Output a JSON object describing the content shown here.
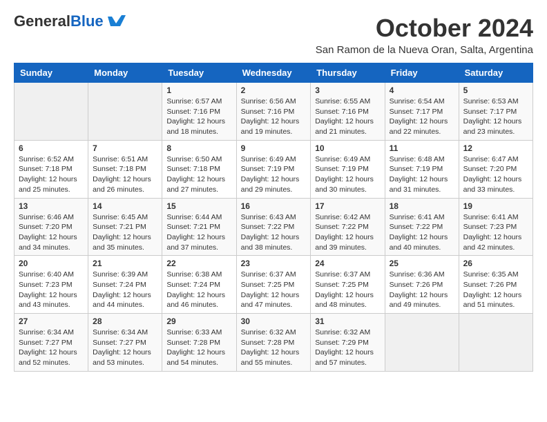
{
  "header": {
    "logo_general": "General",
    "logo_blue": "Blue",
    "month_title": "October 2024",
    "location": "San Ramon de la Nueva Oran, Salta, Argentina"
  },
  "weekdays": [
    "Sunday",
    "Monday",
    "Tuesday",
    "Wednesday",
    "Thursday",
    "Friday",
    "Saturday"
  ],
  "weeks": [
    [
      {
        "day": "",
        "info": ""
      },
      {
        "day": "",
        "info": ""
      },
      {
        "day": "1",
        "info": "Sunrise: 6:57 AM\nSunset: 7:16 PM\nDaylight: 12 hours and 18 minutes."
      },
      {
        "day": "2",
        "info": "Sunrise: 6:56 AM\nSunset: 7:16 PM\nDaylight: 12 hours and 19 minutes."
      },
      {
        "day": "3",
        "info": "Sunrise: 6:55 AM\nSunset: 7:16 PM\nDaylight: 12 hours and 21 minutes."
      },
      {
        "day": "4",
        "info": "Sunrise: 6:54 AM\nSunset: 7:17 PM\nDaylight: 12 hours and 22 minutes."
      },
      {
        "day": "5",
        "info": "Sunrise: 6:53 AM\nSunset: 7:17 PM\nDaylight: 12 hours and 23 minutes."
      }
    ],
    [
      {
        "day": "6",
        "info": "Sunrise: 6:52 AM\nSunset: 7:18 PM\nDaylight: 12 hours and 25 minutes."
      },
      {
        "day": "7",
        "info": "Sunrise: 6:51 AM\nSunset: 7:18 PM\nDaylight: 12 hours and 26 minutes."
      },
      {
        "day": "8",
        "info": "Sunrise: 6:50 AM\nSunset: 7:18 PM\nDaylight: 12 hours and 27 minutes."
      },
      {
        "day": "9",
        "info": "Sunrise: 6:49 AM\nSunset: 7:19 PM\nDaylight: 12 hours and 29 minutes."
      },
      {
        "day": "10",
        "info": "Sunrise: 6:49 AM\nSunset: 7:19 PM\nDaylight: 12 hours and 30 minutes."
      },
      {
        "day": "11",
        "info": "Sunrise: 6:48 AM\nSunset: 7:19 PM\nDaylight: 12 hours and 31 minutes."
      },
      {
        "day": "12",
        "info": "Sunrise: 6:47 AM\nSunset: 7:20 PM\nDaylight: 12 hours and 33 minutes."
      }
    ],
    [
      {
        "day": "13",
        "info": "Sunrise: 6:46 AM\nSunset: 7:20 PM\nDaylight: 12 hours and 34 minutes."
      },
      {
        "day": "14",
        "info": "Sunrise: 6:45 AM\nSunset: 7:21 PM\nDaylight: 12 hours and 35 minutes."
      },
      {
        "day": "15",
        "info": "Sunrise: 6:44 AM\nSunset: 7:21 PM\nDaylight: 12 hours and 37 minutes."
      },
      {
        "day": "16",
        "info": "Sunrise: 6:43 AM\nSunset: 7:22 PM\nDaylight: 12 hours and 38 minutes."
      },
      {
        "day": "17",
        "info": "Sunrise: 6:42 AM\nSunset: 7:22 PM\nDaylight: 12 hours and 39 minutes."
      },
      {
        "day": "18",
        "info": "Sunrise: 6:41 AM\nSunset: 7:22 PM\nDaylight: 12 hours and 40 minutes."
      },
      {
        "day": "19",
        "info": "Sunrise: 6:41 AM\nSunset: 7:23 PM\nDaylight: 12 hours and 42 minutes."
      }
    ],
    [
      {
        "day": "20",
        "info": "Sunrise: 6:40 AM\nSunset: 7:23 PM\nDaylight: 12 hours and 43 minutes."
      },
      {
        "day": "21",
        "info": "Sunrise: 6:39 AM\nSunset: 7:24 PM\nDaylight: 12 hours and 44 minutes."
      },
      {
        "day": "22",
        "info": "Sunrise: 6:38 AM\nSunset: 7:24 PM\nDaylight: 12 hours and 46 minutes."
      },
      {
        "day": "23",
        "info": "Sunrise: 6:37 AM\nSunset: 7:25 PM\nDaylight: 12 hours and 47 minutes."
      },
      {
        "day": "24",
        "info": "Sunrise: 6:37 AM\nSunset: 7:25 PM\nDaylight: 12 hours and 48 minutes."
      },
      {
        "day": "25",
        "info": "Sunrise: 6:36 AM\nSunset: 7:26 PM\nDaylight: 12 hours and 49 minutes."
      },
      {
        "day": "26",
        "info": "Sunrise: 6:35 AM\nSunset: 7:26 PM\nDaylight: 12 hours and 51 minutes."
      }
    ],
    [
      {
        "day": "27",
        "info": "Sunrise: 6:34 AM\nSunset: 7:27 PM\nDaylight: 12 hours and 52 minutes."
      },
      {
        "day": "28",
        "info": "Sunrise: 6:34 AM\nSunset: 7:27 PM\nDaylight: 12 hours and 53 minutes."
      },
      {
        "day": "29",
        "info": "Sunrise: 6:33 AM\nSunset: 7:28 PM\nDaylight: 12 hours and 54 minutes."
      },
      {
        "day": "30",
        "info": "Sunrise: 6:32 AM\nSunset: 7:28 PM\nDaylight: 12 hours and 55 minutes."
      },
      {
        "day": "31",
        "info": "Sunrise: 6:32 AM\nSunset: 7:29 PM\nDaylight: 12 hours and 57 minutes."
      },
      {
        "day": "",
        "info": ""
      },
      {
        "day": "",
        "info": ""
      }
    ]
  ]
}
